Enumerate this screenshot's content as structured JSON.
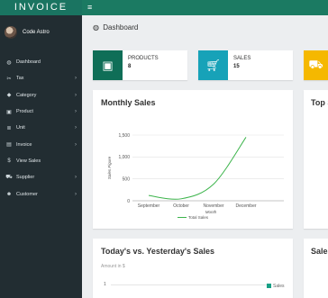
{
  "app": {
    "brand": "INVOICE"
  },
  "user": {
    "name": "Code Astro"
  },
  "sidebar": {
    "items": [
      {
        "label": "Dashboard",
        "icon": "dashboard-icon",
        "has_submenu": false
      },
      {
        "label": "Tax",
        "icon": "tools-icon",
        "has_submenu": true
      },
      {
        "label": "Category",
        "icon": "tag-icon",
        "has_submenu": true
      },
      {
        "label": "Product",
        "icon": "cube-icon",
        "has_submenu": true
      },
      {
        "label": "Unit",
        "icon": "list-icon",
        "has_submenu": true
      },
      {
        "label": "Invoice",
        "icon": "file-icon",
        "has_submenu": true
      },
      {
        "label": "View Sales",
        "icon": "dollar-icon",
        "has_submenu": false
      },
      {
        "label": "Supplier",
        "icon": "truck-icon",
        "has_submenu": true
      },
      {
        "label": "Customer",
        "icon": "users-icon",
        "has_submenu": true
      }
    ]
  },
  "header": {
    "breadcrumb": "Dashboard"
  },
  "info_boxes": [
    {
      "label": "PRODUCTS",
      "value": "8",
      "color": "#0f6e57",
      "icon": "cube-icon"
    },
    {
      "label": "SALES",
      "value": "15",
      "color": "#17a2b8",
      "icon": "cart-icon"
    },
    {
      "label": "",
      "value": "",
      "color": "#f5b800",
      "icon": "truck-icon"
    }
  ],
  "cards": {
    "monthly_sales": "Monthly Sales",
    "top_partial": "Top S",
    "today_vs_yesterday": "Today's vs. Yesterday's Sales",
    "sales_partial": "Sales",
    "amount_label": "Amount in $",
    "mini_tick": "1",
    "mini_legend": "Sales"
  },
  "chart_data": {
    "type": "line",
    "categories": [
      "September",
      "October",
      "November",
      "December"
    ],
    "series": [
      {
        "name": "Total Sales",
        "color": "#3cb44b",
        "values": [
          120,
          45,
          380,
          1450
        ]
      }
    ],
    "xlabel": "Month",
    "ylabel": "Sales Figure",
    "ylim": [
      0,
      1500
    ],
    "yticks": [
      0,
      500,
      1000,
      1500
    ],
    "ytick_labels": [
      "0",
      "500",
      "1,000",
      "1,500"
    ],
    "grid": true,
    "legend": "bottom"
  }
}
